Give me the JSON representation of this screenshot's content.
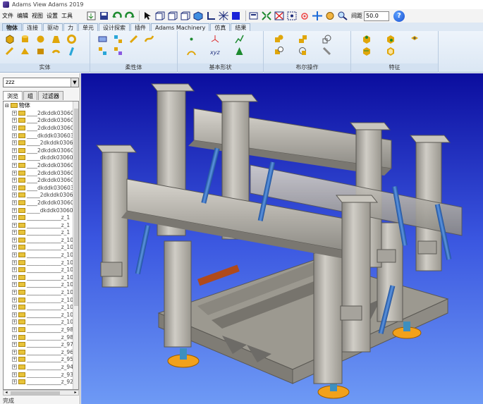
{
  "window": {
    "title": "Adams View Adams 2019"
  },
  "menu": {
    "items": [
      "文件",
      "编辑",
      "视图",
      "设置",
      "工具"
    ]
  },
  "toolbar": {
    "grid_label": "间距",
    "grid_value": "50.0",
    "icons": [
      "import-icon",
      "save-icon",
      "undo-icon",
      "redo-icon",
      "select-arrow-icon",
      "view-front-icon",
      "view-side-icon",
      "view-top-icon",
      "view-iso-icon",
      "coordinate-icon",
      "mesh-icon",
      "blue-square-icon",
      "render-icon",
      "fit-icon",
      "zoom-box-icon",
      "center-icon",
      "translate-icon",
      "rotate-icon",
      "zoom-icon"
    ],
    "help_label": "?"
  },
  "ribbon": {
    "tabs": [
      "物体",
      "连接",
      "驱动",
      "力",
      "单元",
      "设计探索",
      "插件",
      "Adams Machinery",
      "仿真",
      "结果"
    ],
    "active_tab": "物体",
    "groups": [
      {
        "name": "实体",
        "icons": [
          "box-icon",
          "cylinder-icon",
          "sphere-icon",
          "frustum-icon",
          "torus-icon",
          "link-icon",
          "extrusion-icon",
          "revolution-icon",
          "plate-icon",
          "chain-icon"
        ]
      },
      {
        "name": "柔性体",
        "icons": [
          "flex-body-icon",
          "discrete-flex-icon",
          "viewflex-icon",
          "flex-beam-icon",
          "flex-swap-icon",
          "flex-mesh-icon"
        ]
      },
      {
        "name": "基本形状",
        "icons": [
          "point-icon",
          "marker-icon",
          "polyline-icon",
          "arc-icon",
          "xyz-marker-icon",
          "cone-marker-icon"
        ]
      },
      {
        "name": "布尔操作",
        "icons": [
          "union-icon",
          "merge-icon",
          "intersect-icon",
          "cut-icon",
          "split-icon",
          "chain-bool-icon"
        ]
      },
      {
        "name": "特征",
        "icons": [
          "chamfer-icon",
          "fillet-icon",
          "hole-icon",
          "boss-icon",
          "hollow-icon"
        ]
      }
    ]
  },
  "browser": {
    "combo_value": "zzz",
    "tabs": [
      "浏览",
      "组",
      "过滤器"
    ],
    "active_tab": "浏览",
    "root_label": "物体",
    "items": [
      "____2dkddk030603",
      "____2dkddk030603",
      "____2dkddk030603",
      "____dkddk030603c",
      "_____2dkddk0306",
      "____2dkddk030603",
      "_____dkddk03060",
      "____2dkddk030603",
      "____2dkddk030603",
      "____2dkddk030603",
      "____dkddk030603c",
      "_____2dkddk0306",
      "____2dkddk030603",
      "_____dkddk03060",
      "_____________z_1",
      "_____________z_1",
      "_____________z_1",
      "_____________z_10",
      "_____________z_10",
      "_____________z_10",
      "_____________z_10",
      "_____________z_10",
      "_____________z_10",
      "_____________z_10",
      "_____________z_10",
      "_____________z_10",
      "_____________z_10",
      "_____________z_10",
      "_____________z_10",
      "_____________z_98",
      "_____________z_98",
      "_____________z_97",
      "_____________z_96",
      "_____________z_95",
      "_____________z_94",
      "_____________z_93",
      "_____________z_92"
    ],
    "status_text": "完成"
  },
  "colors": {
    "viewport_top": "#0b0d9e",
    "viewport_bottom": "#6e9af5",
    "frame_gray": "#b9b6ae",
    "cylinder_blue": "#2d66b5",
    "foot_orange": "#f2a11b",
    "rail_dark": "#6d6b67"
  }
}
